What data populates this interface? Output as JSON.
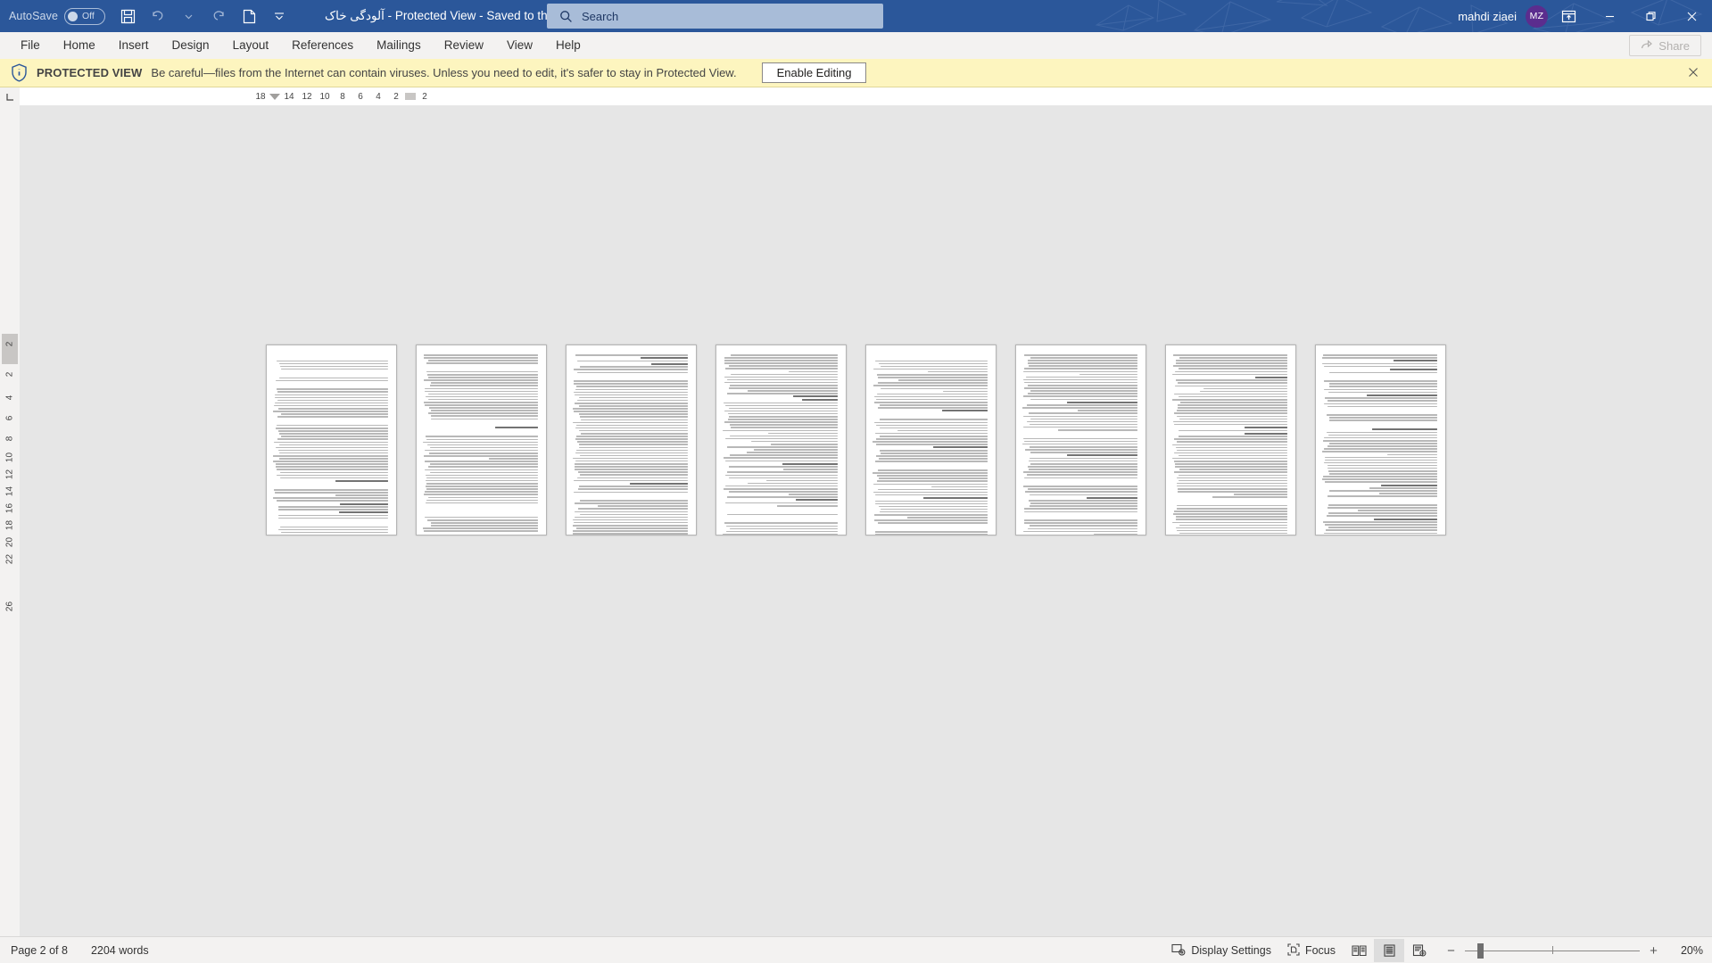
{
  "titlebar": {
    "autosave_label": "AutoSave",
    "autosave_state": "Off",
    "icons": {
      "save": "save-icon",
      "undo": "undo-icon",
      "undo_dropdown": "chevron-down-icon",
      "redo": "redo-icon",
      "new_doc": "new-document-icon",
      "customize_qat": "customize-quick-access-toolbar-icon"
    },
    "document_title": "آلودگی خاک  -  Protected View  -  Saved to this PC",
    "title_dropdown": "▾",
    "search_placeholder": "Search",
    "search_icon": "search-icon",
    "user_name": "mahdi ziaei",
    "user_initials": "MZ",
    "ribbon_display_icon": "ribbon-display-options-icon",
    "minimize": "—",
    "restore": "❐",
    "close": "✕",
    "bg_color": "#2b579a",
    "avatar_color": "#5b2d8e"
  },
  "ribbon": {
    "tabs": [
      {
        "label": "File"
      },
      {
        "label": "Home"
      },
      {
        "label": "Insert"
      },
      {
        "label": "Design"
      },
      {
        "label": "Layout"
      },
      {
        "label": "References"
      },
      {
        "label": "Mailings"
      },
      {
        "label": "Review"
      },
      {
        "label": "View"
      },
      {
        "label": "Help"
      }
    ],
    "share_label": "Share",
    "share_icon": "share-icon"
  },
  "protected_view": {
    "icon": "shield-info-icon",
    "title": "PROTECTED VIEW",
    "message": "Be careful—files from the Internet can contain viruses. Unless you need to edit, it's safer to stay in Protected View.",
    "button_label": "Enable Editing",
    "close_icon": "close-icon",
    "bg_color": "#fdf5bf"
  },
  "rulers": {
    "corner_icon": "tab-selector-icon",
    "horizontal_numbers": [
      "18",
      "14",
      "12",
      "10",
      "8",
      "6",
      "4",
      "2",
      "2"
    ],
    "vertical_numbers": [
      "2",
      "2",
      "4",
      "6",
      "8",
      "10",
      "12",
      "14",
      "16",
      "18",
      "20",
      "22",
      "26"
    ]
  },
  "document": {
    "page_count_visible": 8,
    "selected_page_index": 1,
    "pages": [
      {
        "name": "page-1"
      },
      {
        "name": "page-2"
      },
      {
        "name": "page-3"
      },
      {
        "name": "page-4"
      },
      {
        "name": "page-5"
      },
      {
        "name": "page-6"
      },
      {
        "name": "page-7"
      },
      {
        "name": "page-8"
      }
    ]
  },
  "statusbar": {
    "page_indicator": "Page 2 of 8",
    "word_count": "2204 words",
    "display_settings_label": "Display Settings",
    "display_settings_icon": "display-settings-icon",
    "focus_label": "Focus",
    "focus_icon": "focus-icon",
    "view_read_icon": "read-mode-icon",
    "view_print_icon": "print-layout-icon",
    "view_web_icon": "web-layout-icon",
    "zoom_out": "−",
    "zoom_in": "+",
    "zoom_value": "20%"
  }
}
